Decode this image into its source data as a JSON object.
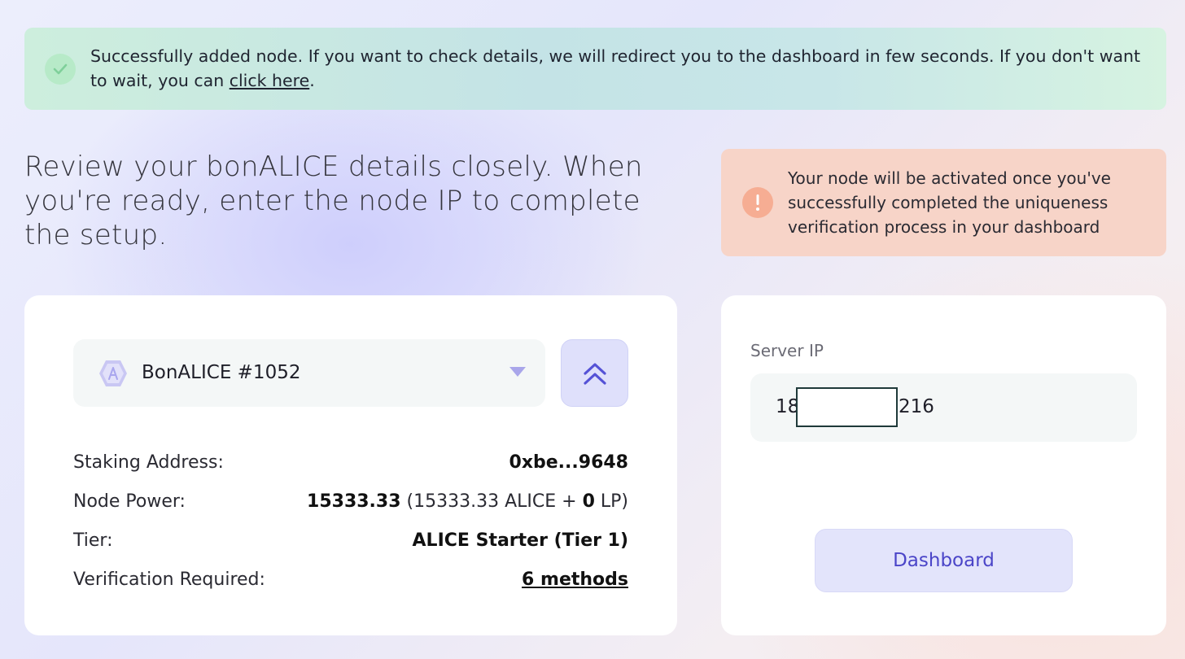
{
  "banner": {
    "icon": "check-circle-icon",
    "text": "Successfully added node. If you want to check details, we will redirect you to the dashboard in few seconds. If you don't want to wait, you can ",
    "link": "click here",
    "suffix": "."
  },
  "headline": "Review your bonALICE details closely. When you're ready, enter the node IP to complete the setup.",
  "warning": {
    "icon": "exclamation-circle-icon",
    "text": "Your node will be activated once you've successfully completed the uniqueness verification process in your dashboard"
  },
  "node_select": {
    "icon": "hexagon-alice-icon",
    "selected": "BonALICE #1052",
    "caret_icon": "caret-down-icon",
    "collapse_icon": "double-chevron-up-icon"
  },
  "details": {
    "staking_label": "Staking Address:",
    "staking_value": "0xbe...9648",
    "power_label": "Node Power:",
    "power_value": "15333.33",
    "power_open": " (",
    "power_alice": "15333.33",
    "power_alice_unit": " ALICE + ",
    "power_lp": "0",
    "power_lp_unit": " LP)",
    "tier_label": "Tier:",
    "tier_value": "ALICE Starter (Tier 1)",
    "verification_label": "Verification Required:",
    "verification_value": "6 methods"
  },
  "server": {
    "label": "Server IP",
    "ip_prefix": "18",
    "ip_suffix": "216",
    "dashboard_button": "Dashboard"
  },
  "colors": {
    "accent": "#4b45c8",
    "success_bg": "#c8e8e3",
    "warning_bg": "#f7d4c8",
    "warning_icon": "#f6ad93",
    "success_icon": "#b7eac8"
  }
}
